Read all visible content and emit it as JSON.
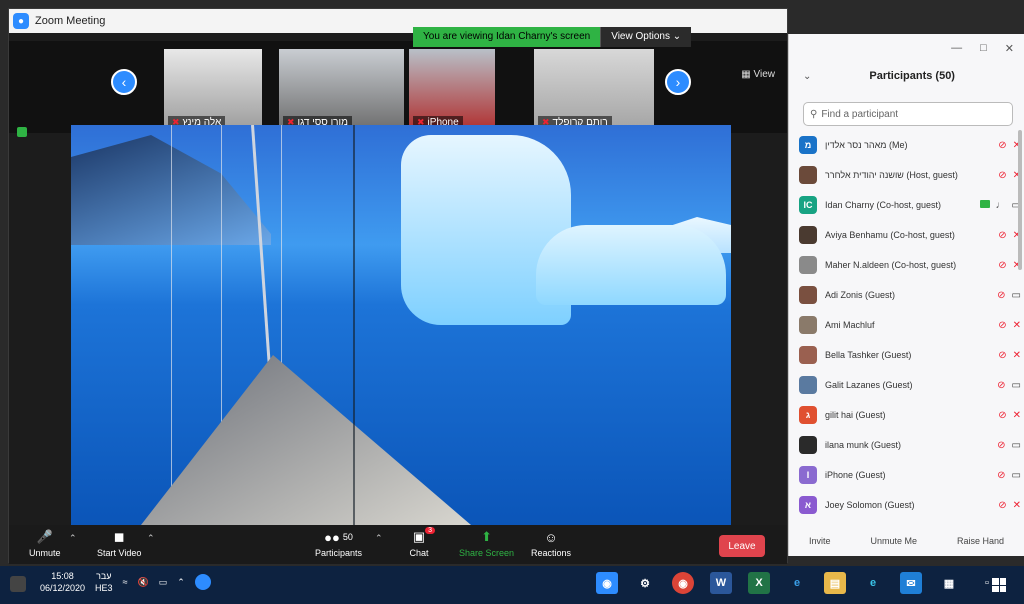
{
  "window": {
    "title": "Zoom Meeting"
  },
  "banner": {
    "text": "You are viewing Idan Charny's screen",
    "view_options": "View Options ⌄"
  },
  "strip": {
    "view_label": "View",
    "thumbs": [
      {
        "name": "אלה מינץ"
      },
      {
        "name": "מורן ססי דגן"
      },
      {
        "name": "iPhone"
      },
      {
        "name": "רותם קרופלד"
      }
    ]
  },
  "toolbar": {
    "unmute": "Unmute",
    "start_video": "Start Video",
    "participants": "Participants",
    "participants_count": "50",
    "chat": "Chat",
    "chat_badge": "3",
    "share_screen": "Share Screen",
    "reactions": "Reactions",
    "leave": "Leave"
  },
  "panel": {
    "title": "Participants (50)",
    "search_placeholder": "Find a participant",
    "participants": [
      {
        "name": "מאהר נסר אלדין (Me)",
        "initial": "מ",
        "color": "#1a73c8",
        "mic": "off",
        "cam": "off"
      },
      {
        "name": "שושנה יהודית אלחרר (Host, guest)",
        "initial": "",
        "color": "#6b4a3a",
        "mic": "off",
        "cam": "off"
      },
      {
        "name": "Idan Charny (Co-host, guest)",
        "initial": "IC",
        "color": "#17a383",
        "mic": "on",
        "cam": "on",
        "sharing": true
      },
      {
        "name": "Aviya Benhamu (Co-host, guest)",
        "initial": "",
        "color": "#4a3a30",
        "mic": "off",
        "cam": "off"
      },
      {
        "name": "Maher N.aldeen (Co-host, guest)",
        "initial": "",
        "color": "#8a8a8a",
        "mic": "off",
        "cam": "off"
      },
      {
        "name": "Adi Zonis (Guest)",
        "initial": "",
        "color": "#7a5040",
        "mic": "off",
        "cam": "on"
      },
      {
        "name": "Ami Machluf",
        "initial": "",
        "color": "#8a7a6a",
        "mic": "off",
        "cam": "off"
      },
      {
        "name": "Bella Tashker (Guest)",
        "initial": "",
        "color": "#9a6050",
        "mic": "off",
        "cam": "off"
      },
      {
        "name": "Galit Lazanes (Guest)",
        "initial": "",
        "color": "#5a7aa0",
        "mic": "off",
        "cam": "on"
      },
      {
        "name": "gilit hai (Guest)",
        "initial": "ג",
        "color": "#e05030",
        "mic": "off",
        "cam": "off"
      },
      {
        "name": "ilana munk (Guest)",
        "initial": "",
        "color": "#2a2a2a",
        "mic": "off",
        "cam": "on"
      },
      {
        "name": "iPhone (Guest)",
        "initial": "I",
        "color": "#8a6ad0",
        "mic": "off",
        "cam": "on"
      },
      {
        "name": "Joey Solomon (Guest)",
        "initial": "א",
        "color": "#8a5ad0",
        "mic": "off",
        "cam": "off"
      }
    ],
    "footer": {
      "invite": "Invite",
      "unmute_me": "Unmute Me",
      "raise_hand": "Raise Hand"
    }
  },
  "taskbar": {
    "time": "15:08",
    "date": "06/12/2020",
    "lang_top": "עבר",
    "lang_bottom": "HE3"
  }
}
